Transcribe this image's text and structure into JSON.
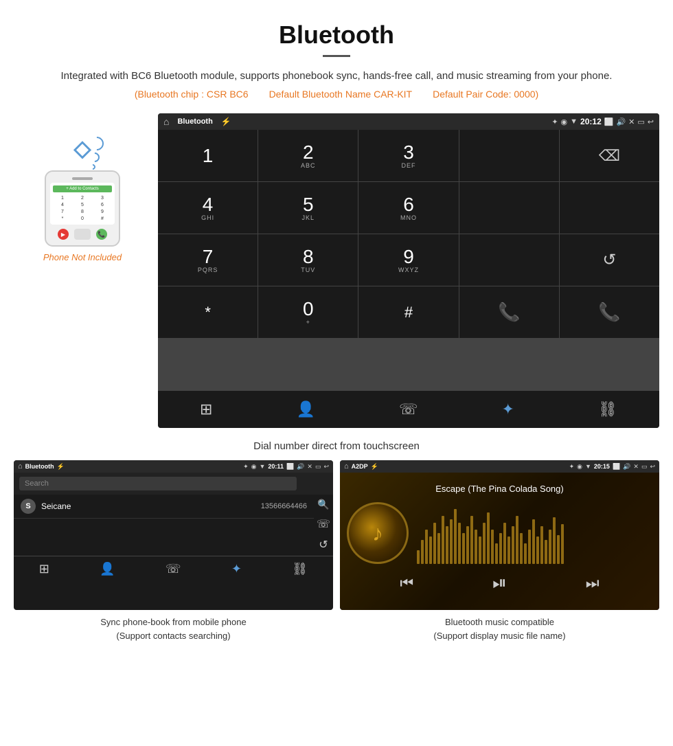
{
  "header": {
    "title": "Bluetooth",
    "description": "Integrated with BC6 Bluetooth module, supports phonebook sync, hands-free call, and music streaming from your phone.",
    "specs": {
      "chip": "(Bluetooth chip : CSR BC6",
      "name": "Default Bluetooth Name CAR-KIT",
      "code": "Default Pair Code: 0000)"
    }
  },
  "phone_label": "Phone Not Included",
  "main_screen": {
    "status_bar": {
      "title": "Bluetooth",
      "time": "20:12"
    },
    "dialpad": [
      {
        "main": "1",
        "sub": ""
      },
      {
        "main": "2",
        "sub": "ABC"
      },
      {
        "main": "3",
        "sub": "DEF"
      },
      {
        "main": "",
        "sub": ""
      },
      {
        "main": "⌫",
        "sub": ""
      },
      {
        "main": "4",
        "sub": "GHI"
      },
      {
        "main": "5",
        "sub": "JKL"
      },
      {
        "main": "6",
        "sub": "MNO"
      },
      {
        "main": "",
        "sub": ""
      },
      {
        "main": "",
        "sub": ""
      },
      {
        "main": "7",
        "sub": "PQRS"
      },
      {
        "main": "8",
        "sub": "TUV"
      },
      {
        "main": "9",
        "sub": "WXYZ"
      },
      {
        "main": "",
        "sub": ""
      },
      {
        "main": "↺",
        "sub": ""
      },
      {
        "main": "*",
        "sub": ""
      },
      {
        "main": "0",
        "sub": "+"
      },
      {
        "main": "#",
        "sub": ""
      },
      {
        "main": "📞",
        "sub": ""
      },
      {
        "main": "📞red",
        "sub": ""
      }
    ]
  },
  "main_caption": "Dial number direct from touchscreen",
  "phonebook_screen": {
    "title": "Bluetooth",
    "time": "20:11",
    "search_placeholder": "Search",
    "contact": {
      "letter": "S",
      "name": "Seicane",
      "number": "13566664466"
    }
  },
  "phonebook_caption": "Sync phone-book from mobile phone\n(Support contacts searching)",
  "music_screen": {
    "title": "A2DP",
    "time": "20:15",
    "song_title": "Escape (The Pina Colada Song)"
  },
  "music_caption": "Bluetooth music compatible\n(Support display music file name)"
}
